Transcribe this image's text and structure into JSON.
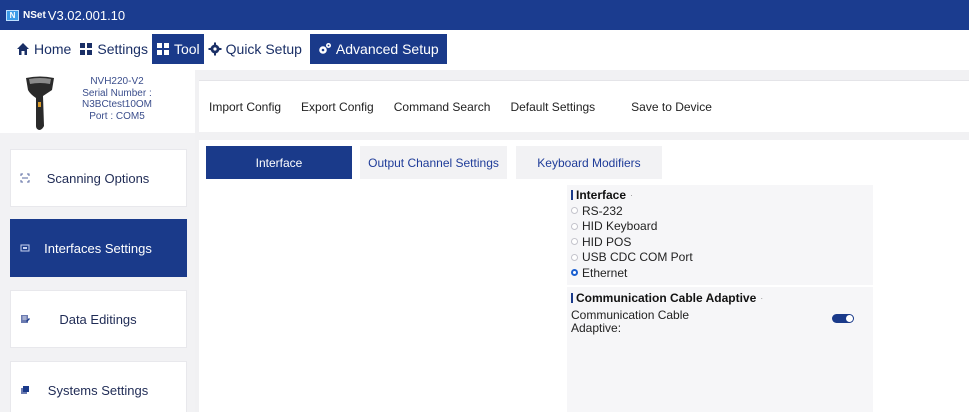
{
  "app": {
    "logo_text": "N",
    "brand": "NSet",
    "version": "V3.02.001.10"
  },
  "menu": {
    "home": "Home",
    "settings": "Settings",
    "tool": "Tool",
    "quick_setup": "Quick Setup",
    "advanced_setup": "Advanced Setup"
  },
  "device": {
    "model": "NVH220-V2",
    "serial_label": "Serial Number :",
    "serial": "N3BCtest10OM",
    "port": "Port : COM5"
  },
  "sidebar": {
    "items": [
      {
        "label": "Scanning Options",
        "icon": "scan-icon"
      },
      {
        "label": "Interfaces Settings",
        "icon": "interface-icon"
      },
      {
        "label": "Data Editings",
        "icon": "data-edit-icon"
      },
      {
        "label": "Systems Settings",
        "icon": "system-icon"
      }
    ],
    "active_index": 1
  },
  "toolbar": {
    "import": "Import Config",
    "export": "Export Config",
    "command_search": "Command Search",
    "default_settings": "Default Settings",
    "save": "Save to Device"
  },
  "tabs": [
    {
      "label": "Interface"
    },
    {
      "label": "Output Channel Settings"
    },
    {
      "label": "Keyboard Modifiers"
    }
  ],
  "interface_section": {
    "title": "Interface",
    "marker": "·",
    "options": [
      "RS-232",
      "HID Keyboard",
      "HID POS",
      "USB CDC COM Port",
      "Ethernet"
    ],
    "selected": "Ethernet"
  },
  "cable_section": {
    "title": "Communication Cable Adaptive",
    "marker": "·",
    "setting_label_line1": "Communication Cable",
    "setting_label_line2": "Adaptive:",
    "enabled": true
  },
  "colors": {
    "title_bar": "#1b3c8f",
    "accent": "#1a3a8a",
    "tab_text": "#1f3c99",
    "radio_checked": "#1a5fd0"
  }
}
